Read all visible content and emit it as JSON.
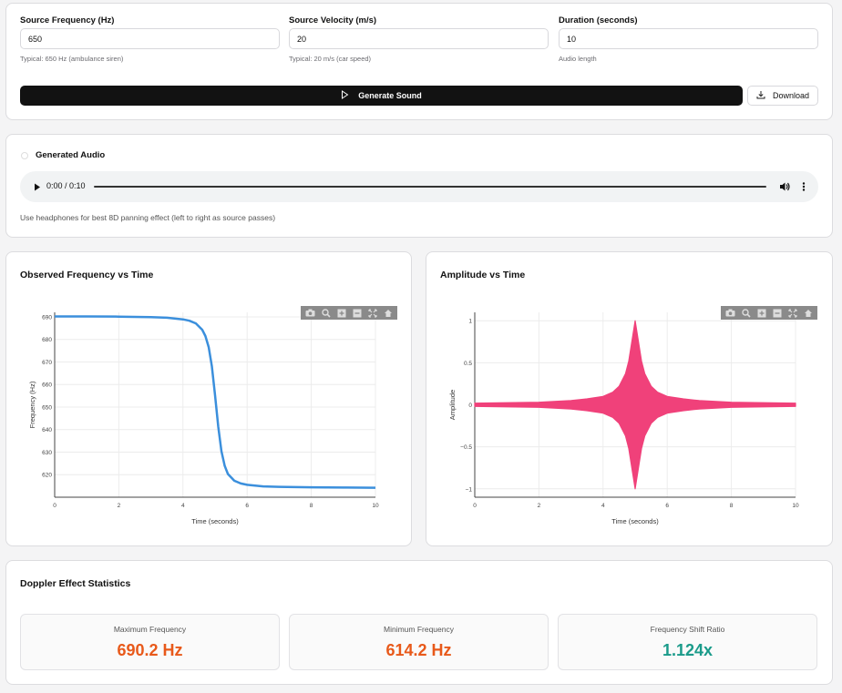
{
  "params": {
    "source_frequency": {
      "label": "Source Frequency (Hz)",
      "value": "650",
      "hint": "Typical: 650 Hz (ambulance siren)"
    },
    "source_velocity": {
      "label": "Source Velocity (m/s)",
      "value": "20",
      "hint": "Typical: 20 m/s (car speed)"
    },
    "duration": {
      "label": "Duration (seconds)",
      "value": "10",
      "hint": "Audio length"
    },
    "generate_label": "Generate Sound",
    "download_label": "Download"
  },
  "audio": {
    "title": "Generated Audio",
    "time": "0:00 / 0:10",
    "note": "Use headphones for best 8D panning effect (left to right as source passes)"
  },
  "freq_chart_title": "Observed Frequency vs Time",
  "amp_chart_title": "Amplitude vs Time",
  "chart_data": [
    {
      "type": "line",
      "xlabel": "Time (seconds)",
      "ylabel": "Frequency (Hz)",
      "xlim": [
        0,
        10
      ],
      "ylim": [
        610,
        692
      ],
      "xticks": [
        0,
        2,
        4,
        6,
        8,
        10
      ],
      "yticks": [
        620,
        630,
        640,
        650,
        660,
        670,
        680,
        690
      ],
      "color": "#3b8fdc",
      "grid": true,
      "x": [
        0,
        1,
        2,
        3,
        3.5,
        4,
        4.2,
        4.4,
        4.6,
        4.7,
        4.8,
        4.9,
        5.0,
        5.1,
        5.2,
        5.3,
        5.4,
        5.6,
        5.8,
        6,
        6.5,
        7,
        8,
        9,
        10
      ],
      "y": [
        690.2,
        690.2,
        690.1,
        689.9,
        689.6,
        688.9,
        688.3,
        687.1,
        684.3,
        681.5,
        676.6,
        668.1,
        655.2,
        641.3,
        630.4,
        623.9,
        620.3,
        617.3,
        616.1,
        615.5,
        614.8,
        614.6,
        614.4,
        614.3,
        614.2
      ]
    },
    {
      "type": "area",
      "xlabel": "Time (seconds)",
      "ylabel": "Amplitude",
      "xlim": [
        0,
        10
      ],
      "ylim": [
        -1.1,
        1.1
      ],
      "xticks": [
        0,
        2,
        4,
        6,
        8,
        10
      ],
      "yticks": [
        -1,
        -0.5,
        0,
        0.5,
        1
      ],
      "color": "#f0417a",
      "grid": true,
      "x": [
        0,
        1,
        2,
        3,
        3.5,
        4,
        4.3,
        4.5,
        4.7,
        4.8,
        4.9,
        5.0,
        5.1,
        5.2,
        5.3,
        5.5,
        5.7,
        6,
        6.5,
        7,
        8,
        9,
        10
      ],
      "envelope": [
        0.02,
        0.025,
        0.03,
        0.05,
        0.07,
        0.1,
        0.15,
        0.22,
        0.37,
        0.52,
        0.76,
        1.0,
        0.76,
        0.52,
        0.37,
        0.22,
        0.15,
        0.1,
        0.07,
        0.05,
        0.03,
        0.025,
        0.02
      ]
    }
  ],
  "stats": {
    "title": "Doppler Effect Statistics",
    "items": [
      {
        "label": "Maximum Frequency",
        "value": "690.2 Hz",
        "color": "#e8591a"
      },
      {
        "label": "Minimum Frequency",
        "value": "614.2 Hz",
        "color": "#e8591a"
      },
      {
        "label": "Frequency Shift Ratio",
        "value": "1.124x",
        "color": "#1a9b8a"
      }
    ]
  }
}
